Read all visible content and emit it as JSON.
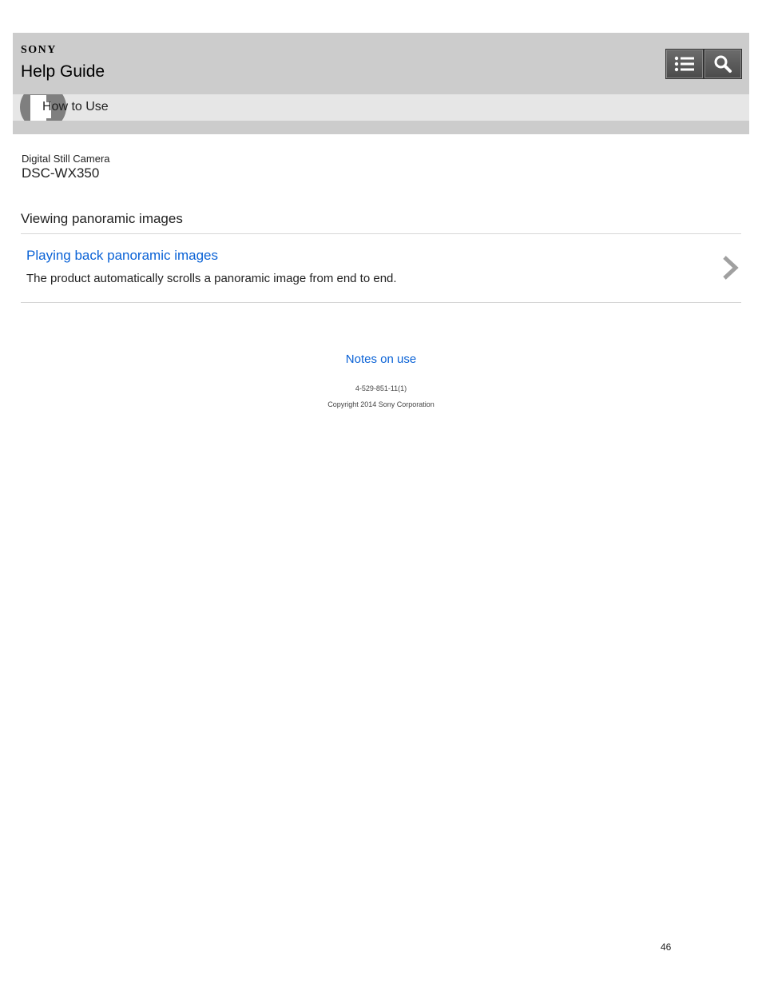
{
  "header": {
    "brand": "SONY",
    "title": "Help Guide",
    "menu_icon": "list-icon",
    "search_icon": "search-icon",
    "breadcrumb": "How to Use"
  },
  "product": {
    "category": "Digital Still Camera",
    "model": "DSC-WX350"
  },
  "section": {
    "title": "Viewing panoramic images",
    "items": [
      {
        "link": "Playing back panoramic images",
        "description": "The product automatically scrolls a panoramic image from end to end."
      }
    ]
  },
  "footer": {
    "notes_link": "Notes on use",
    "doc_code": "4-529-851-11(1)",
    "copyright": "Copyright 2014 Sony Corporation",
    "page_number": "46"
  },
  "colors": {
    "header_bg": "#cccccc",
    "subbar_bg": "#e6e6e6",
    "link": "#0a62d6"
  }
}
